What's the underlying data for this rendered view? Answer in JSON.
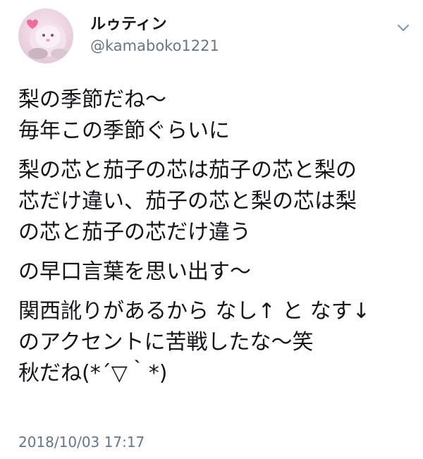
{
  "user": {
    "display_name": "ルゥティン",
    "handle": "@kamaboko1221",
    "avatar_icon": "avatar-image"
  },
  "menu": {
    "icon": "chevron-down-icon"
  },
  "tweet": {
    "paragraphs": [
      [
        "梨の季節だね〜",
        "毎年この季節ぐらいに"
      ],
      [
        "梨の芯と茄子の芯は茄子の芯と梨の",
        "芯だけ違い、茄子の芯と梨の芯は梨",
        "の芯と茄子の芯だけ違う"
      ],
      [
        "の早口言葉を思い出す〜"
      ],
      [
        "関西訛りがあるから なし↑ と なす↓",
        "のアクセントに苦戦したな〜笑",
        "秋だね(*´▽｀*)"
      ]
    ],
    "timestamp": "2018/10/03 17:17"
  },
  "colors": {
    "text": "#14171a",
    "secondary": "#657786"
  }
}
